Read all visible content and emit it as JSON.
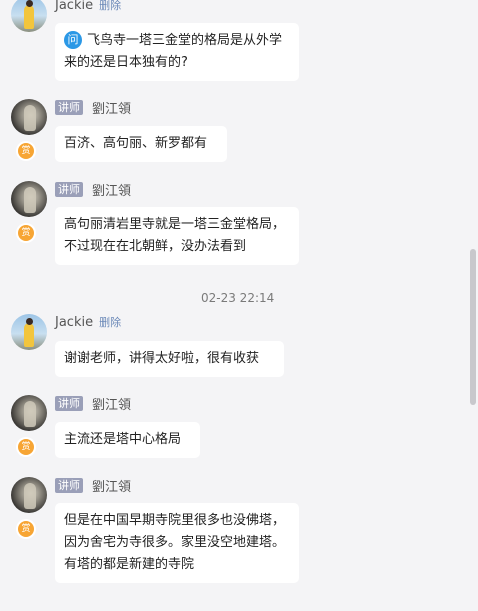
{
  "messages": [
    {
      "badge": "",
      "name": "Jackie",
      "delete_label": "删除",
      "text": "飞鸟寺一塔三金堂的格局是从外学来的还是日本独有的?",
      "question_icon": "问"
    },
    {
      "badge": "讲师",
      "name": "劉江領",
      "reward": "赏",
      "text": "百济、高句丽、新罗都有"
    },
    {
      "badge": "讲师",
      "name": "劉江領",
      "reward": "赏",
      "text": "高句丽清岩里寺就是一塔三金堂格局，不过现在在北朝鲜，没办法看到"
    },
    {
      "badge": "",
      "name": "Jackie",
      "delete_label": "删除",
      "text": "谢谢老师，讲得太好啦，很有收获"
    },
    {
      "badge": "讲师",
      "name": "劉江領",
      "reward": "赏",
      "text": "主流还是塔中心格局"
    },
    {
      "badge": "讲师",
      "name": "劉江領",
      "reward": "赏",
      "text": "但是在中国早期寺院里很多也没佛塔，因为舍宅为寺很多。家里没空地建塔。有塔的都是新建的寺院"
    }
  ],
  "timestamp": "02-23 22:14"
}
